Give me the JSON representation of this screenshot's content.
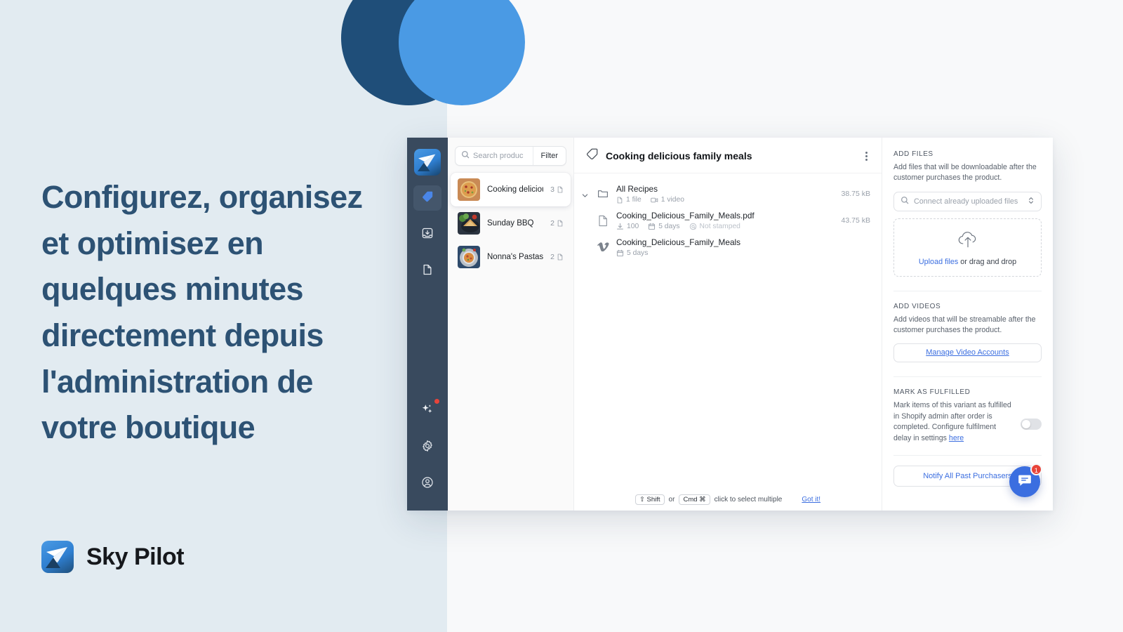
{
  "marketing": {
    "headline": "Configurez, organisez et optimisez en quelques minutes directement depuis l'administration de votre boutique",
    "brand_name": "Sky Pilot",
    "colors": {
      "background": "#e2ebf1",
      "headline": "#2d5274",
      "circle_dark": "#1f4e79",
      "circle_light": "#4a9ae4",
      "accent_blue": "#3b6ee0"
    }
  },
  "app": {
    "rail": {
      "logo_icon": "paper-plane-icon",
      "items": [
        {
          "icon": "tag-icon",
          "active": true,
          "badge": false
        },
        {
          "icon": "inbox-download-icon",
          "active": false,
          "badge": false
        },
        {
          "icon": "page-file-icon",
          "active": false,
          "badge": false
        },
        {
          "icon": "sparkles-icon",
          "active": false,
          "badge": true
        },
        {
          "icon": "gear-icon",
          "active": false,
          "badge": false
        },
        {
          "icon": "account-circle-icon",
          "active": false,
          "badge": false
        }
      ]
    },
    "product_list": {
      "search_placeholder": "Search produc",
      "search_value": "",
      "filter_label": "Filter",
      "items": [
        {
          "title": "Cooking delicious f...",
          "count": "3",
          "selected": true,
          "thumb": "pizza"
        },
        {
          "title": "Sunday BBQ",
          "count": "2",
          "selected": false,
          "thumb": "bbq"
        },
        {
          "title": "Nonna's Pastas",
          "count": "2",
          "selected": false,
          "thumb": "pasta"
        }
      ]
    },
    "main": {
      "title": "Cooking delicious family meals",
      "title_icon": "tag-icon",
      "menu_icon": "kebab-menu-icon",
      "rows": [
        {
          "name": "All Recipes",
          "icon": "folder-icon",
          "expandable": true,
          "size": "38.75 kB",
          "meta": [
            {
              "icon": "file-icon",
              "text": "1 file"
            },
            {
              "icon": "video-icon",
              "text": "1 video"
            }
          ]
        },
        {
          "name": "Cooking_Delicious_Family_Meals.pdf",
          "icon": "file-icon",
          "expandable": false,
          "size": "43.75 kB",
          "meta": [
            {
              "icon": "download-icon",
              "text": "100"
            },
            {
              "icon": "calendar-icon",
              "text": "5 days"
            },
            {
              "icon": "stamp-icon",
              "text": "Not stamped"
            }
          ]
        },
        {
          "name": "Cooking_Delicious_Family_Meals",
          "icon": "vimeo-icon",
          "expandable": false,
          "size": "",
          "meta": [
            {
              "icon": "calendar-icon",
              "text": "5 days"
            }
          ]
        }
      ],
      "hint": {
        "key1": "⇧ Shift",
        "conj": "or",
        "key2": "Cmd ⌘",
        "text": "click to select multiple",
        "dismiss": "Got it!"
      }
    },
    "props": {
      "add_files": {
        "title": "ADD FILES",
        "description": "Add files that will be downloadable after the customer purchases the product.",
        "connect_placeholder": "Connect already uploaded files",
        "upload_link": "Upload files",
        "upload_rest": " or drag and drop",
        "upload_icon": "cloud-upload-icon"
      },
      "add_videos": {
        "title": "ADD VIDEOS",
        "description": "Add videos that will be streamable after the customer purchases the product.",
        "button_label": "Manage Video Accounts"
      },
      "mark_fulfilled": {
        "title": "MARK AS FULFILLED",
        "description_1": "Mark items of this variant as fulfilled in Shopify admin after order is completed. Configure fulfilment delay in settings ",
        "description_link": "here",
        "toggle_on": false
      },
      "notify_button": "Notify All Past Purchasers"
    },
    "chat": {
      "icon": "chat-bubble-icon",
      "badge_count": "1"
    }
  }
}
